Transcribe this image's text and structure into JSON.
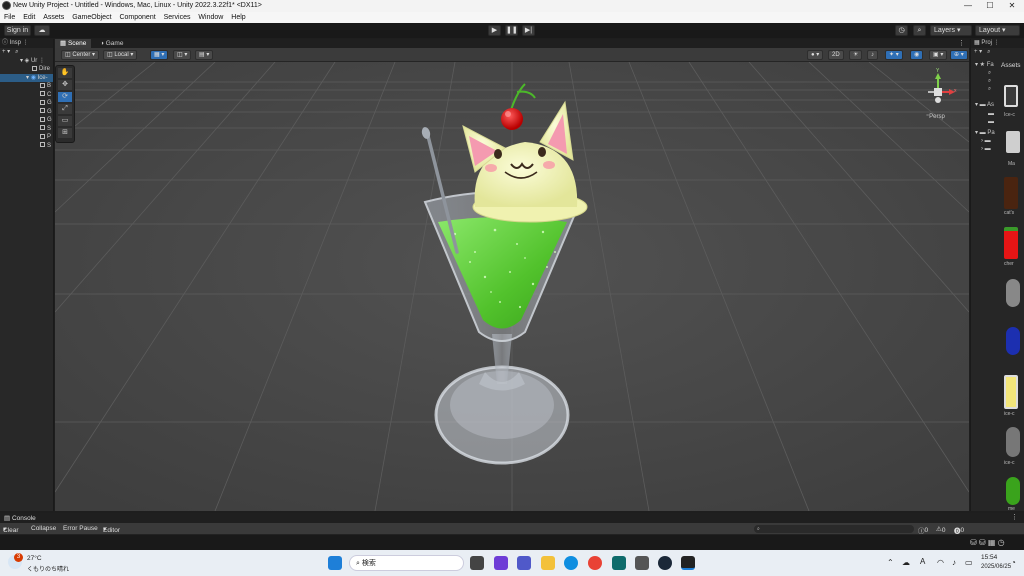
{
  "window": {
    "title": "New Unity Project - Untitled - Windows, Mac, Linux - Unity 2022.3.22f1* <DX11>",
    "minimize": "—",
    "maximize": "☐",
    "close": "✕"
  },
  "menu": [
    "File",
    "Edit",
    "Assets",
    "GameObject",
    "Component",
    "Services",
    "Window",
    "Help"
  ],
  "toolbar": {
    "sign_in": "Sign in",
    "layers": "Layers",
    "layout": "Layout"
  },
  "hierarchy": {
    "tab_label": "Insp",
    "root": "Ur",
    "items": [
      "Dire",
      "Ice-",
      "B",
      "C",
      "G",
      "G",
      "G",
      "S",
      "P",
      "S"
    ]
  },
  "scene": {
    "tabs": [
      "Scene",
      "Game"
    ],
    "pivot": "Center",
    "space": "Local",
    "mode_2d": "2D",
    "persp_label": "Persp",
    "gizmo_y": "Y",
    "gizmo_x": "x"
  },
  "project": {
    "tab_label": "Proj",
    "assets_header": "Assets",
    "fav_label": "Fa",
    "folder_as": "As",
    "folder_pa": "Pa",
    "items": [
      "Ice-c",
      "Ma",
      "cat's",
      "cher",
      "ice-c",
      "ice-c",
      "me"
    ]
  },
  "console": {
    "tab_label": "Console",
    "clear": "Clear",
    "collapse": "Collapse",
    "error_pause": "Error Pause",
    "editor": "Editor",
    "count_info": "0",
    "count_warn": "0",
    "count_error": "0"
  },
  "taskbar": {
    "weather_temp": "27°C",
    "weather_desc": "くもりのち晴れ",
    "weather_badge": "3",
    "search_placeholder": "検索",
    "time": "15:54",
    "date": "2025/06/25",
    "ime": "A"
  },
  "colors": {
    "scene_bg": "#474747",
    "accent_blue": "#2f6fb5",
    "drink_green": "#62d23a",
    "cat_cream": "#f3f4b8"
  }
}
